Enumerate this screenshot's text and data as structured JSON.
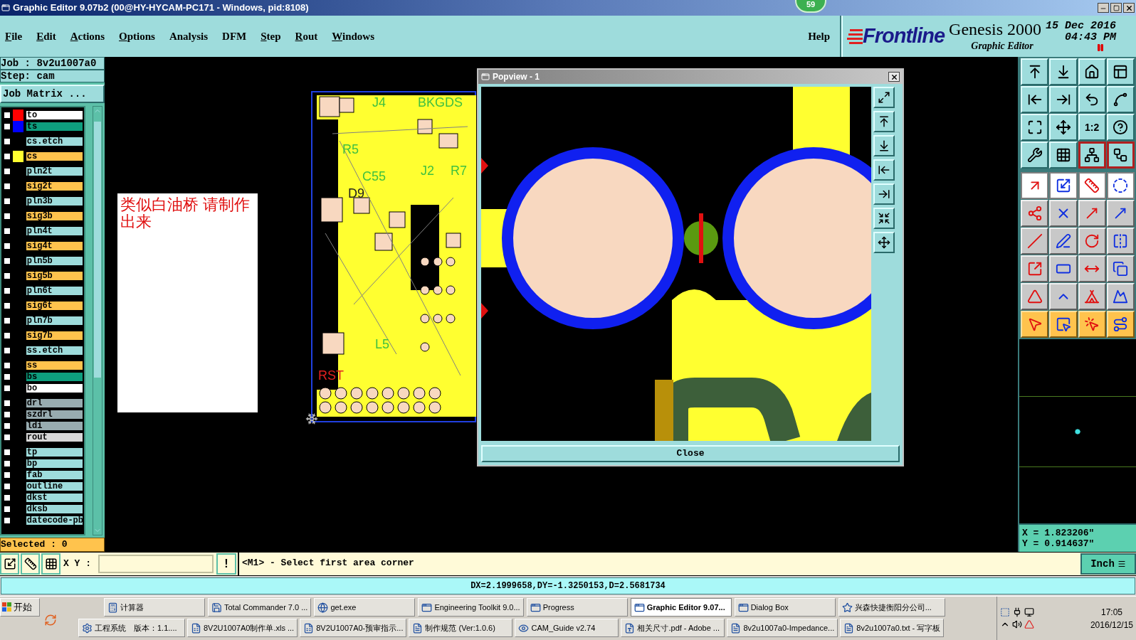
{
  "title_bar": {
    "title": "Graphic Editor 9.07b2 (00@HY-HYCAM-PC171 - Windows, pid:8108)"
  },
  "notification_badge": "59",
  "menu": [
    {
      "label": "File",
      "underlined_initial": true
    },
    {
      "label": "Edit",
      "underlined_initial": true
    },
    {
      "label": "Actions",
      "underlined_initial": true
    },
    {
      "label": "Options",
      "underlined_initial": true
    },
    {
      "label": "Analysis",
      "underlined_initial": false
    },
    {
      "label": "DFM",
      "underlined_initial": false
    },
    {
      "label": "Step",
      "underlined_initial": true
    },
    {
      "label": "Rout",
      "underlined_initial": true
    },
    {
      "label": "Windows",
      "underlined_initial": true
    }
  ],
  "help": "Help",
  "brand": {
    "logo": "Frontline",
    "product": "Genesis 2000",
    "subtitle": "Graphic Editor",
    "date": "15 Dec 2016",
    "time": "04:43 PM"
  },
  "job_panel": {
    "job": "Job : 8v2u1007a0",
    "step": "Step: cam",
    "matrix_button": "Job Matrix ...",
    "layer_groups": [
      [
        {
          "name": "to",
          "kind": "legend",
          "color": "#ff0000",
          "checked": false
        },
        {
          "name": "ts",
          "kind": "mask",
          "color": "#0000ff",
          "checked": false
        }
      ],
      [
        {
          "name": "cs.etch",
          "kind": "doc",
          "checked": false
        }
      ],
      [
        {
          "name": "cs",
          "kind": "signal",
          "color": "#ffff30",
          "checked": false
        }
      ],
      [
        {
          "name": "pln2t",
          "kind": "doc",
          "checked": false
        }
      ],
      [
        {
          "name": "sig2t",
          "kind": "signal",
          "checked": false
        }
      ],
      [
        {
          "name": "pln3b",
          "kind": "doc",
          "checked": false
        }
      ],
      [
        {
          "name": "sig3b",
          "kind": "signal",
          "checked": false
        }
      ],
      [
        {
          "name": "pln4t",
          "kind": "doc",
          "checked": false
        }
      ],
      [
        {
          "name": "sig4t",
          "kind": "signal",
          "checked": false
        }
      ],
      [
        {
          "name": "pln5b",
          "kind": "doc",
          "checked": false
        }
      ],
      [
        {
          "name": "sig5b",
          "kind": "signal",
          "checked": false
        }
      ],
      [
        {
          "name": "pln6t",
          "kind": "doc",
          "checked": false
        }
      ],
      [
        {
          "name": "sig6t",
          "kind": "signal",
          "checked": false
        }
      ],
      [
        {
          "name": "pln7b",
          "kind": "doc",
          "checked": false
        }
      ],
      [
        {
          "name": "sig7b",
          "kind": "signal",
          "checked": false
        }
      ],
      [
        {
          "name": "ss.etch",
          "kind": "doc",
          "checked": false
        }
      ],
      [
        {
          "name": "ss",
          "kind": "signal",
          "checked": false
        },
        {
          "name": "bs",
          "kind": "mask",
          "checked": false
        },
        {
          "name": "bo",
          "kind": "legend",
          "checked": false
        }
      ],
      [
        {
          "name": "drl",
          "kind": "drill",
          "checked": false
        },
        {
          "name": "szdrl",
          "kind": "drill",
          "checked": false
        },
        {
          "name": "ldi",
          "kind": "drill",
          "checked": false
        },
        {
          "name": "rout",
          "kind": "rout",
          "checked": false
        }
      ],
      [
        {
          "name": "tp",
          "kind": "doc",
          "checked": false
        },
        {
          "name": "bp",
          "kind": "doc",
          "checked": false
        },
        {
          "name": "fab",
          "kind": "doc",
          "checked": false
        },
        {
          "name": "outline",
          "kind": "doc",
          "checked": false
        },
        {
          "name": "dkst",
          "kind": "doc",
          "checked": false
        },
        {
          "name": "dksb",
          "kind": "doc",
          "checked": false
        },
        {
          "name": "datecode-pb",
          "kind": "doc",
          "checked": false
        }
      ]
    ],
    "selected": "Selected : 0"
  },
  "canvas": {
    "pcb_labels": [
      "J4",
      "BKGDS",
      "R5",
      "C55",
      "J2",
      "R7",
      "D9",
      "L5",
      "RST"
    ],
    "note": "类似白油桥  请制作出来",
    "popview": {
      "title": "Popview - 1",
      "close_button": "Close"
    }
  },
  "toolbar": {
    "ratio_label": "1:2"
  },
  "coordinates": {
    "x": "X = 1.823206\"",
    "y": "Y = 0.914637\""
  },
  "command_bar": {
    "xy_label": "X Y :",
    "alert_button": "!",
    "prompt": "<M1> - Select first area corner",
    "units": "Inch"
  },
  "measure": "DX=2.1999658,DY=-1.3250153,D=2.5681734",
  "taskbar": {
    "start": "开始",
    "row_1": [
      {
        "label": "计算器",
        "selected": false
      },
      {
        "label": "Total Commander 7.0 ...",
        "selected": false
      },
      {
        "label": "get.exe",
        "selected": false
      },
      {
        "label": "Engineering Toolkit 9.0...",
        "selected": false
      },
      {
        "label": "Progress",
        "selected": false
      },
      {
        "label": "Graphic Editor 9.07...",
        "selected": true
      },
      {
        "label": "Dialog Box",
        "selected": false
      },
      {
        "label": "兴森快捷衡阳分公司...",
        "selected": false
      }
    ],
    "row_2": [
      {
        "label": "工程系统　版本：1.1....",
        "selected": false
      },
      {
        "label": "8V2U1007A0制作单.xls ...",
        "selected": false
      },
      {
        "label": "8V2U1007A0-预审指示...",
        "selected": false
      },
      {
        "label": "制作规范 (Ver:1.0.6)",
        "selected": false
      },
      {
        "label": "CAM_Guide v2.74",
        "selected": false
      },
      {
        "label": "相关尺寸.pdf - Adobe ...",
        "selected": false
      },
      {
        "label": "8v2u1007a0-Impedance...",
        "selected": false
      },
      {
        "label": "8v2u1007a0.txt - 写字板",
        "selected": false
      }
    ],
    "clock_time": "17:05",
    "clock_date": "2016/12/15"
  }
}
